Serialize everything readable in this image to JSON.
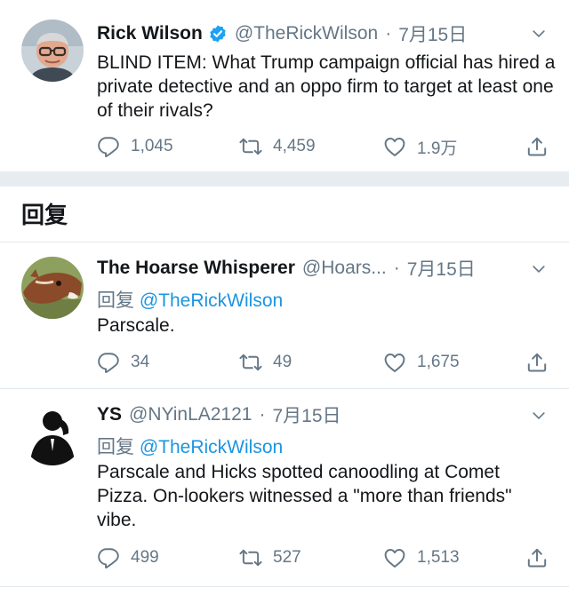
{
  "main_tweet": {
    "name": "Rick Wilson",
    "handle": "@TheRickWilson",
    "separator": "·",
    "time": "7月15日",
    "text": "BLIND ITEM: What Trump campaign official has hired a private detective and an oppo firm to target at least one of their rivals?",
    "replies": "1,045",
    "retweets": "4,459",
    "likes": "1.9万",
    "verified": true
  },
  "replies_section": {
    "title": "回复"
  },
  "replies": [
    {
      "name": "The Hoarse Whisperer",
      "handle": "@Hoars...",
      "separator": "·",
      "time": "7月15日",
      "replying_prefix": "回复",
      "replying_to": "@TheRickWilson",
      "text": "Parscale.",
      "replies": "34",
      "retweets": "49",
      "likes": "1,675"
    },
    {
      "name": "YS",
      "handle": "@NYinLA2121",
      "separator": "·",
      "time": "7月15日",
      "replying_prefix": "回复",
      "replying_to": "@TheRickWilson",
      "text": "Parscale and Hicks spotted canoodling at Comet Pizza. On-lookers witnessed a \"more than friends\" vibe.",
      "replies": "499",
      "retweets": "527",
      "likes": "1,513"
    }
  ],
  "colors": {
    "accent": "#1b95e0",
    "secondary_text": "#657786",
    "verified": "#1da1f2",
    "separator_band": "#e6ecf0"
  }
}
